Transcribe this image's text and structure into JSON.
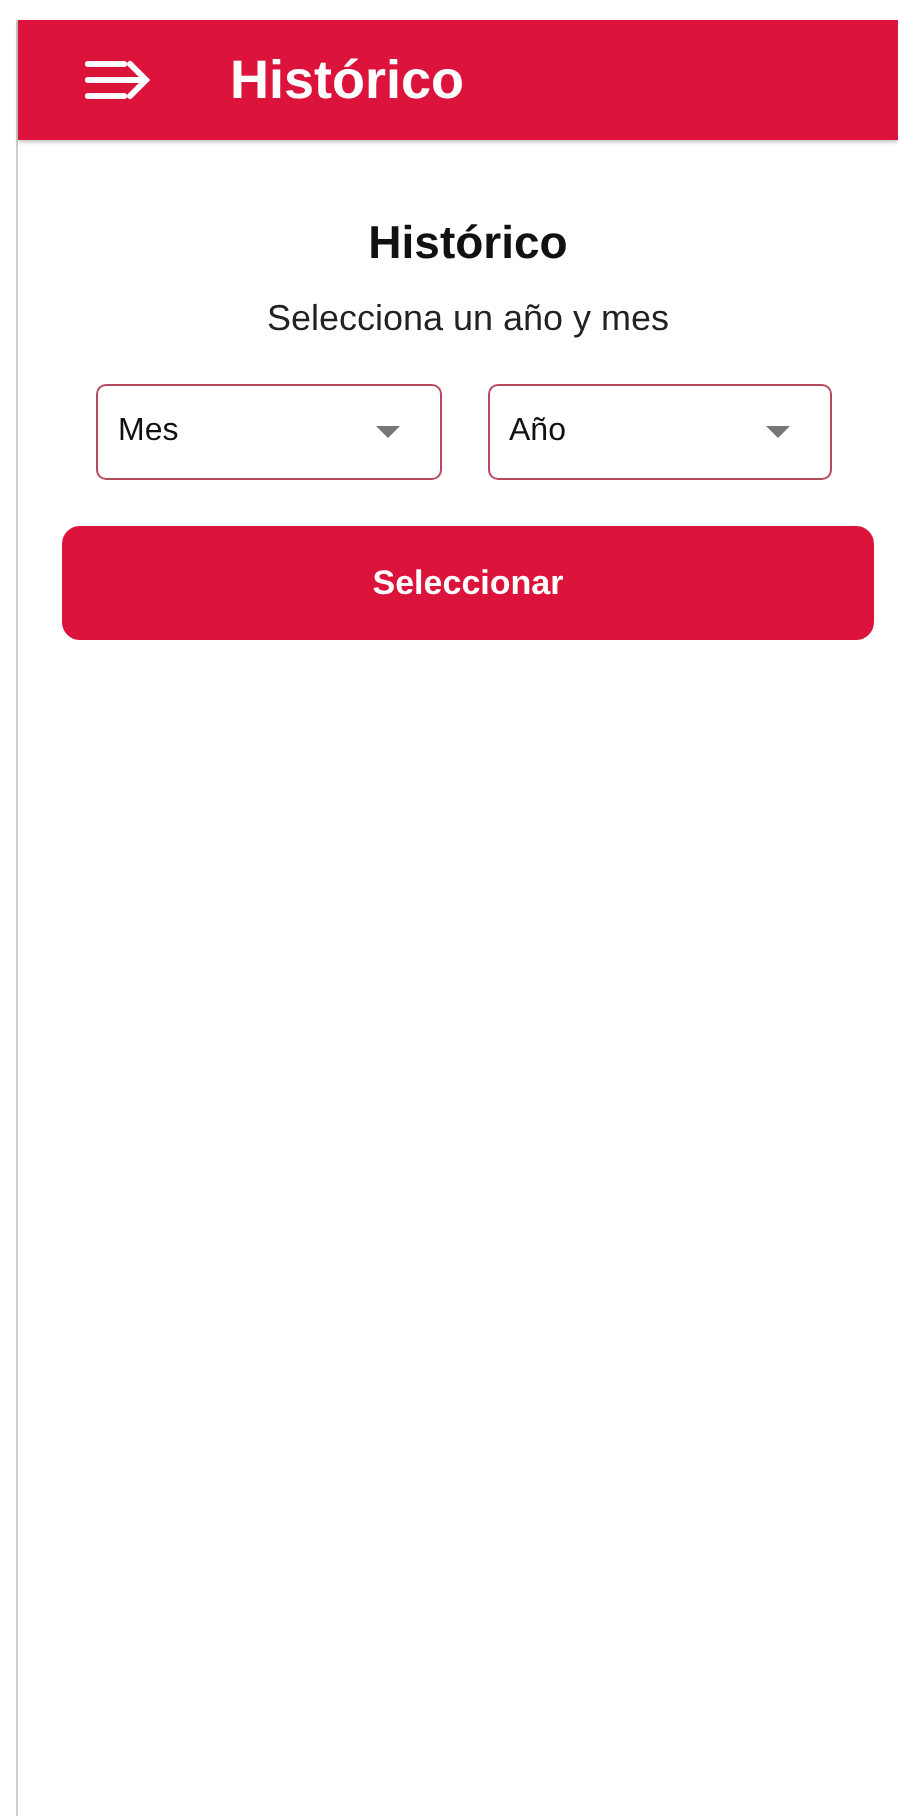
{
  "app_bar": {
    "title": "Histórico"
  },
  "page": {
    "heading": "Histórico",
    "subtitle": "Selecciona un año y mes"
  },
  "dropdowns": [
    {
      "placeholder": "Mes"
    },
    {
      "placeholder": "Año"
    }
  ],
  "button": {
    "label": "Seleccionar"
  }
}
